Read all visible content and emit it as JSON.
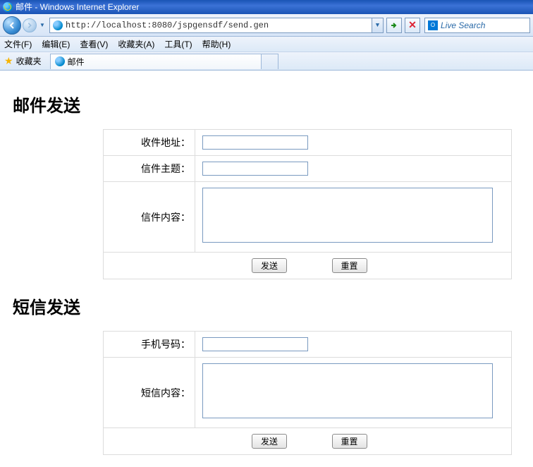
{
  "window": {
    "title": "邮件 - Windows Internet Explorer"
  },
  "address": {
    "url": "http://localhost:8080/jspgensdf/send.gen"
  },
  "search": {
    "placeholder": "Live Search"
  },
  "menu": {
    "file": "文件(F)",
    "edit": "编辑(E)",
    "view": "查看(V)",
    "favorites": "收藏夹(A)",
    "tools": "工具(T)",
    "help": "帮助(H)"
  },
  "favbar": {
    "label": "收藏夹"
  },
  "tab": {
    "title": "邮件"
  },
  "mail": {
    "heading": "邮件发送",
    "recipient_label": "收件地址：",
    "subject_label": "信件主题：",
    "content_label": "信件内容：",
    "send_label": "发送",
    "reset_label": "重置"
  },
  "sms": {
    "heading": "短信发送",
    "phone_label": "手机号码：",
    "content_label": "短信内容：",
    "send_label": "发送",
    "reset_label": "重置"
  }
}
